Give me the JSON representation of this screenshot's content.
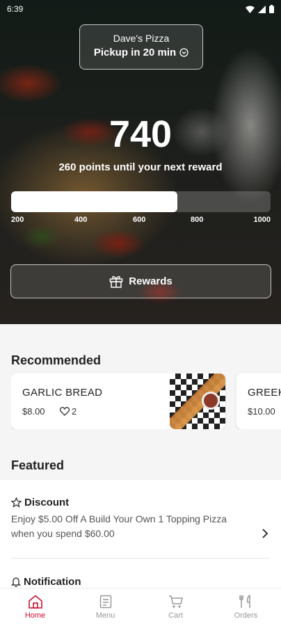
{
  "status": {
    "time": "6:39"
  },
  "store": {
    "name": "Dave's Pizza",
    "pickup": "Pickup in 20 min"
  },
  "rewards": {
    "points": "740",
    "subtitle": "260 points until your next reward",
    "progress_fraction": 0.64,
    "ticks": [
      "200",
      "400",
      "600",
      "800",
      "1000"
    ],
    "button_label": "Rewards"
  },
  "recommended": {
    "title": "Recommended",
    "items": [
      {
        "name": "GARLIC BREAD",
        "price": "$8.00",
        "likes": "2"
      },
      {
        "name": "GREEK",
        "price": "$10.00"
      }
    ]
  },
  "featured": {
    "title": "Featured",
    "items": [
      {
        "title": "Discount",
        "description": "Enjoy $5.00 Off A Build Your Own 1 Topping Pizza when you spend $60.00"
      },
      {
        "title": "Notification"
      }
    ]
  },
  "nav": {
    "home": "Home",
    "menu": "Menu",
    "cart": "Cart",
    "orders": "Orders",
    "active_color": "#c8102e"
  },
  "icons": [
    "signal-icon",
    "wifi-icon",
    "battery-icon",
    "clock-icon",
    "gift-icon",
    "heart-icon",
    "star-icon",
    "bell-icon",
    "chevron-right-icon",
    "home-icon",
    "menu-icon",
    "cart-icon",
    "orders-icon"
  ]
}
